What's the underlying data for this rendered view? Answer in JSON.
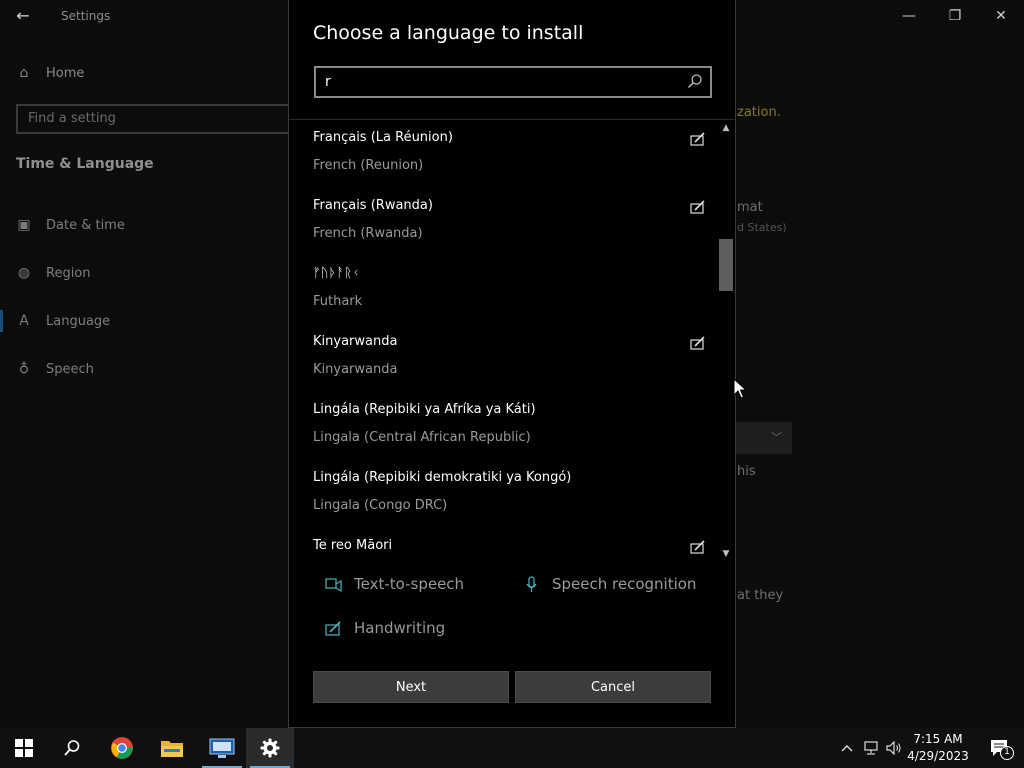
{
  "settings_window": {
    "title": "Settings",
    "back_glyph": "←",
    "minimize_glyph": "—",
    "maximize_glyph": "❐",
    "close_glyph": "✕",
    "home_label": "Home",
    "search_placeholder": "Find a setting",
    "section_title": "Time & Language",
    "nav_items": [
      {
        "label": "Date & time",
        "icon": "calendar-clock-icon"
      },
      {
        "label": "Region",
        "icon": "globe-icon"
      },
      {
        "label": "Language",
        "icon": "language-icon",
        "selected": true
      },
      {
        "label": "Speech",
        "icon": "microphone-icon"
      }
    ],
    "fragments": {
      "f1": "zation.",
      "f2": "mat",
      "f3": "d States)",
      "f4": "his",
      "f5": "at they"
    }
  },
  "dialog": {
    "title": "Choose a language to install",
    "search_value": "r",
    "languages": [
      {
        "native": "Français (La Réunion)",
        "english": "French (Reunion)",
        "handwriting": true
      },
      {
        "native": "Français (Rwanda)",
        "english": "French (Rwanda)",
        "handwriting": true
      },
      {
        "native": "ᚠᚢᚦᚨᚱᚲ",
        "english": "Futhark",
        "handwriting": false
      },
      {
        "native": "Kinyarwanda",
        "english": "Kinyarwanda",
        "handwriting": true
      },
      {
        "native": "Lingála (Repibiki ya Afríka ya Káti)",
        "english": "Lingala (Central African Republic)",
        "handwriting": false
      },
      {
        "native": "Lingála (Repibiki demokratiki ya Kongó)",
        "english": "Lingala (Congo DRC)",
        "handwriting": false
      },
      {
        "native": "Te reo Māori",
        "english": "",
        "handwriting": true
      }
    ],
    "scroll": {
      "up_glyph": "▲",
      "down_glyph": "▼",
      "position_fraction": 0.29
    },
    "features": {
      "tts": "Text-to-speech",
      "speech": "Speech recognition",
      "handwriting": "Handwriting"
    },
    "next_label": "Next",
    "cancel_label": "Cancel"
  },
  "taskbar": {
    "time": "7:15 AM",
    "date": "4/29/2023",
    "notification_count": "1",
    "chevron": "^"
  },
  "colors": {
    "accent": "#6fa8dc",
    "feature_icon": "#4fb3bf",
    "button_bg": "#3c3c3c"
  }
}
